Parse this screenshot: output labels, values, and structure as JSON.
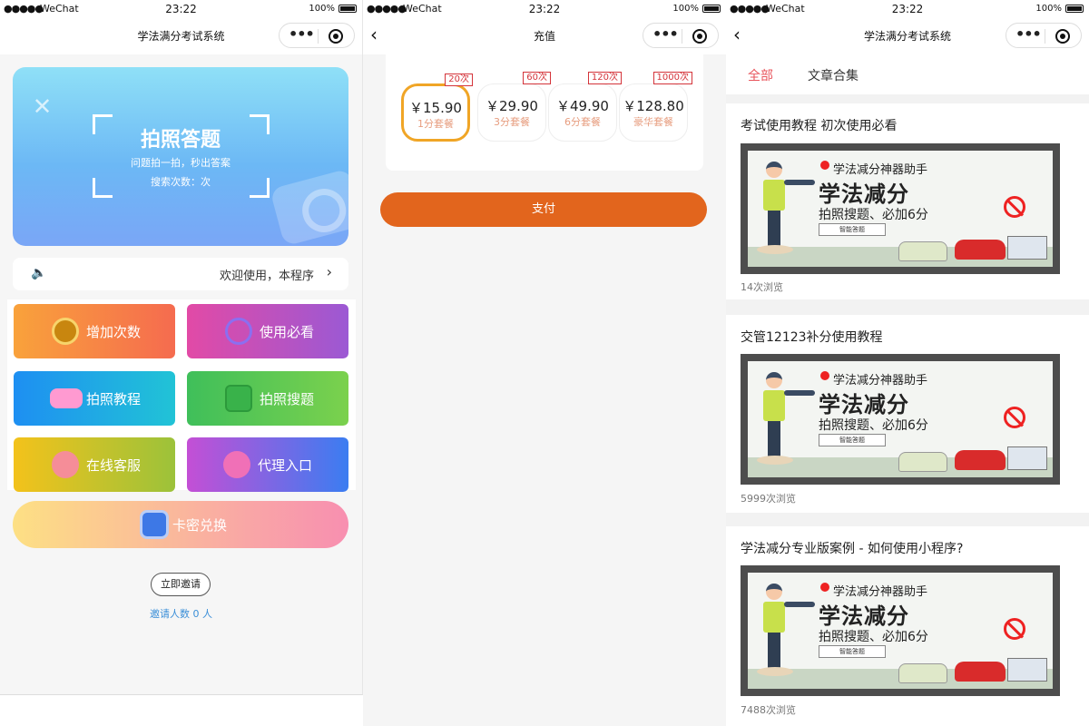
{
  "statusbar": {
    "signal": "●●●●●",
    "carrier": "WeChat",
    "time": "23:22",
    "battery": "100%"
  },
  "screen1": {
    "nav_title": "学法满分考试系统",
    "capsule_more": "•••",
    "hero": {
      "title": "拍照答题",
      "subtitle": "问题拍一拍，秒出答案",
      "search_count": "搜索次数：次"
    },
    "notice": {
      "text": "欢迎使用，本程序",
      "chevron": "›"
    },
    "tiles": [
      {
        "label": "增加次数",
        "icon": "coin-icon"
      },
      {
        "label": "使用必看",
        "icon": "play-icon"
      },
      {
        "label": "拍照教程",
        "icon": "car-icon"
      },
      {
        "label": "拍照搜题",
        "icon": "camera-icon"
      },
      {
        "label": "在线客服",
        "icon": "service-icon"
      },
      {
        "label": "代理入口",
        "icon": "agent-icon"
      }
    ],
    "redeem_label": "卡密兑换",
    "invite_button": "立即邀请",
    "invite_count": "邀请人数 0 人"
  },
  "screen2": {
    "nav_title": "充值",
    "back": "‹",
    "packages": [
      {
        "price": "￥15.90",
        "name": "1分套餐",
        "badge": "20次",
        "selected": true
      },
      {
        "price": "￥29.90",
        "name": "3分套餐",
        "badge": "60次",
        "selected": false
      },
      {
        "price": "￥49.90",
        "name": "6分套餐",
        "badge": "120次",
        "selected": false
      },
      {
        "price": "￥128.80",
        "name": "豪华套餐",
        "badge": "1000次",
        "selected": false
      }
    ],
    "pay_label": "支付",
    "accent_color": "#e2651d"
  },
  "screen3": {
    "nav_title": "学法满分考试系统",
    "back": "‹",
    "tabs": [
      {
        "label": "全部",
        "active": true
      },
      {
        "label": "文章合集",
        "active": false
      }
    ],
    "articles": [
      {
        "title": "考试使用教程 初次使用必看",
        "views": "14次浏览"
      },
      {
        "title": "交管12123补分使用教程",
        "views": "5999次浏览"
      },
      {
        "title": "学法减分专业版案例 - 如何使用小程序?",
        "views": "7488次浏览"
      }
    ],
    "banner": {
      "line1": "学法减分神器助手",
      "line2": "学法减分",
      "line3": "拍照搜题、必加6分",
      "button": "智能答题"
    }
  }
}
